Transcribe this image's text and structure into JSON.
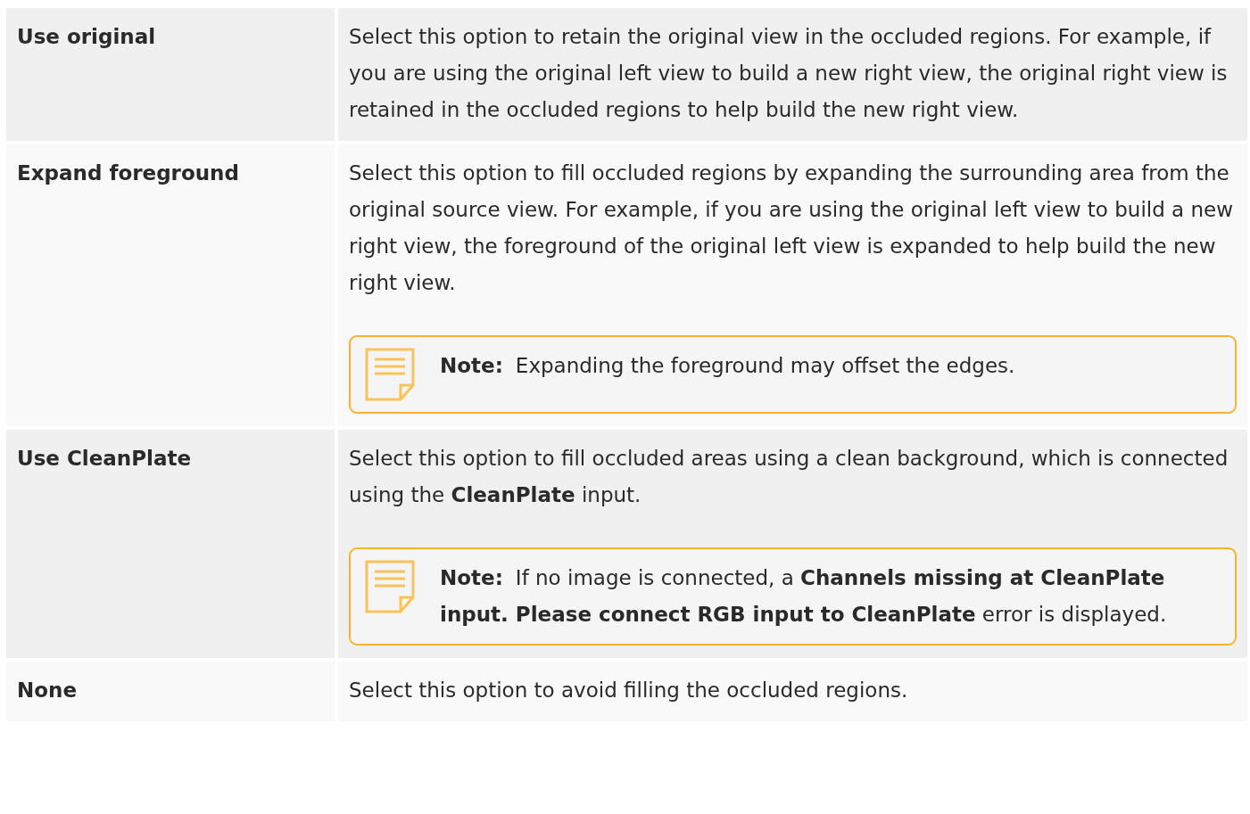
{
  "rows": [
    {
      "option": "Use original",
      "description": "Select this option to retain the original view in the occluded regions. For example, if you are using the original left view to build a new right view, the original right view is retained in the occluded regions to help build the new right view."
    },
    {
      "option": "Expand foreground",
      "description": "Select this option to fill occluded regions by expanding the surrounding area from the original source view. For example, if you are using the original left view to build a new right view, the foreground of the original left view is expanded to help build the new right view.",
      "note": {
        "label": "Note:",
        "text": "Expanding the foreground may offset the edges."
      }
    },
    {
      "option": "Use CleanPlate",
      "description": "Select this option to fill occluded areas using a clean background, which is connected using the **CleanPlate** input.",
      "note": {
        "label": "Note:",
        "text": "If no image is connected, a **Channels missing at CleanPlate input. Please connect RGB input to CleanPlate** error is displayed."
      }
    },
    {
      "option": "None",
      "description": "Select this option to avoid filling the occluded regions."
    }
  ]
}
